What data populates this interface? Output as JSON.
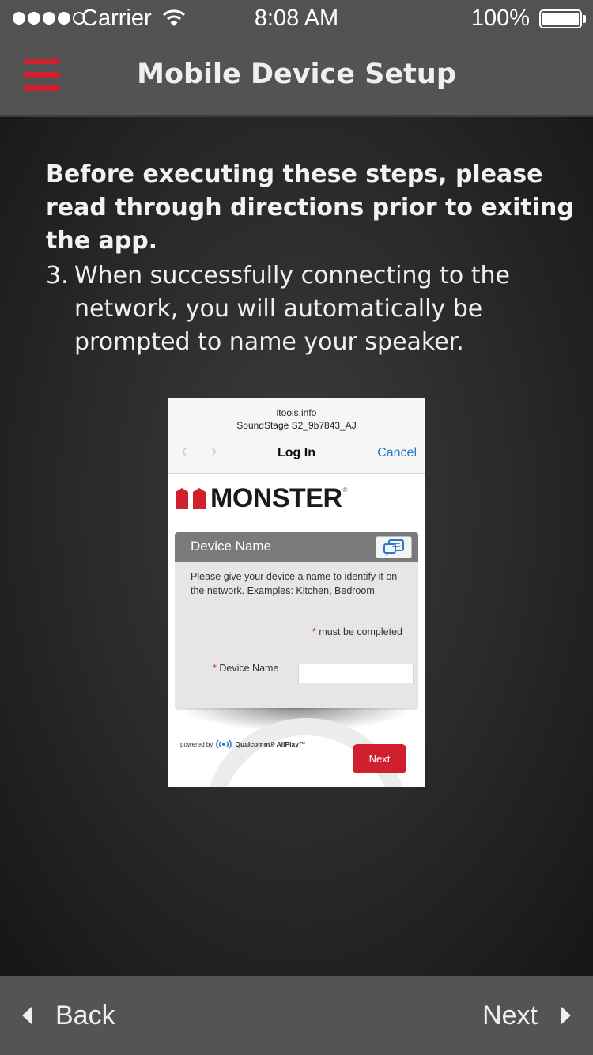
{
  "status_bar": {
    "carrier": "Carrier",
    "time": "8:08 AM",
    "battery_percent": "100%",
    "signal_bars_filled": 4,
    "signal_bars_total": 5,
    "battery_level": 1.0
  },
  "nav": {
    "title": "Mobile Device Setup",
    "menu_icon": "hamburger-menu-icon",
    "menu_color": "#d0202e"
  },
  "content": {
    "intro": "Before executing these steps, please read through directions prior to exiting the app.",
    "step_number": "3.",
    "step_text": "When successfully connecting to the network, you will automatically be prompted to name your speaker."
  },
  "screenshot": {
    "domain": "itools.info",
    "ssid": "SoundStage S2_9b7843_AJ",
    "back_icon": "chevron-left-icon",
    "forward_icon": "chevron-right-icon",
    "login_title": "Log In",
    "cancel_label": "Cancel",
    "logo_text": "MONSTER",
    "logo_reg": "®",
    "card_title": "Device Name",
    "card_desc": "Please give your device a name to identify it on the network. Examples: Kitchen, Bedroom.",
    "required_star": "*",
    "required_text": " must be completed",
    "field_label": "Device Name",
    "powered_by": "powered by",
    "powered_brand": "Qualcomm® AllPlay™",
    "next_label": "Next"
  },
  "bottom": {
    "back_label": "Back",
    "next_label": "Next"
  }
}
